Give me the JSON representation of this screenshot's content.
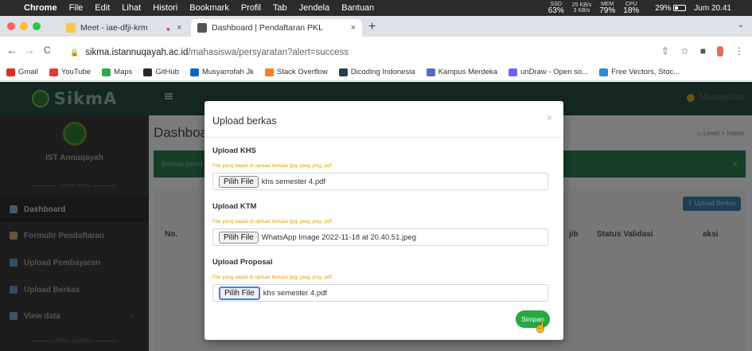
{
  "menubar": {
    "apple": "",
    "app": "Chrome",
    "items": [
      "File",
      "Edit",
      "Lihat",
      "Histori",
      "Bookmark",
      "Profil",
      "Tab",
      "Jendela",
      "Bantuan"
    ],
    "stat1_top": "SSD",
    "stat1_bottom": "63%",
    "stat2_top": "25 KB/s",
    "stat2_bottom": "3 KB/s",
    "stat3_top": "MEM",
    "stat3_bottom": "79%",
    "stat4_top": "CPU",
    "stat4_bottom": "18%",
    "wifi": "",
    "battery": "29%",
    "clock": "Jum 20.41",
    "search": "",
    "controls": ""
  },
  "tabs": {
    "items": [
      {
        "title": "Meet - iae-dfji-krm",
        "color": "#f7c948"
      },
      {
        "title": "Dashboard | Pendaftaran PKL",
        "color": "#555555"
      }
    ],
    "close": "×",
    "new_tab": "+",
    "chevron": "⌄"
  },
  "toolbar": {
    "back": "←",
    "forward": "→",
    "reload": "C",
    "lock": "🔒",
    "url_host": "sikma.istannuqayah.ac.id",
    "url_path": "/mahasiswa/persyaratan?alert=success",
    "share": "⇧",
    "star": "☆",
    "ext": "■",
    "menu": "⋮"
  },
  "bookmarks": [
    {
      "label": "Gmail",
      "color": "#d93025"
    },
    {
      "label": "YouTube",
      "color": "#e53935"
    },
    {
      "label": "Maps",
      "color": "#34a853"
    },
    {
      "label": "GitHub",
      "color": "#24292e"
    },
    {
      "label": "Musyarrofah Jk",
      "color": "#0a66c2"
    },
    {
      "label": "Stack Overflow",
      "color": "#f48024"
    },
    {
      "label": "Dicoding Indonesia",
      "color": "#2d3e50"
    },
    {
      "label": "Kampus Merdeka",
      "color": "#5c6bc0"
    },
    {
      "label": "unDraw - Open so...",
      "color": "#6c63ff"
    },
    {
      "label": "Free Vectors, Stoc...",
      "color": "#2c8ad8"
    }
  ],
  "app": {
    "brand": "SikmA",
    "user": "Musyarrofah",
    "org": "IST Annuqayah",
    "menu_header": "Daftar Menu",
    "menu_footer": "Menu Lainnya",
    "menu": [
      {
        "label": "Dashboard",
        "active": true
      },
      {
        "label": "Formulir Pendaftaran",
        "active": false
      },
      {
        "label": "Upload Pembayaran",
        "active": false
      },
      {
        "label": "Upload Berkas",
        "active": false
      },
      {
        "label": "View data",
        "active": false
      }
    ],
    "view_data_caret": "‹",
    "page_title": "Dashboard",
    "breadcrumb": "Level  >  home",
    "alert_text": "Berkas perm",
    "alert_close": "×",
    "upload_button": "Upload Berkas",
    "table_headers": {
      "no": "No.",
      "col6": "jib",
      "status": "Status Validasi",
      "action": "aksi"
    }
  },
  "modal": {
    "title": "Upload berkas",
    "close": "×",
    "hint": "File yang dapat di upload berupa 'jpg, jpeg, png, pdf'",
    "choose_label": "Pilih File",
    "fields": [
      {
        "label": "Upload KHS",
        "file": "khs semester 4.pdf"
      },
      {
        "label": "Upload KTM",
        "file": "WhatsApp Image 2022-11-18 at 20.40.51.jpeg"
      },
      {
        "label": "Upload Proposal",
        "file": "khs semester 4.pdf"
      }
    ],
    "save": "Simpan"
  }
}
